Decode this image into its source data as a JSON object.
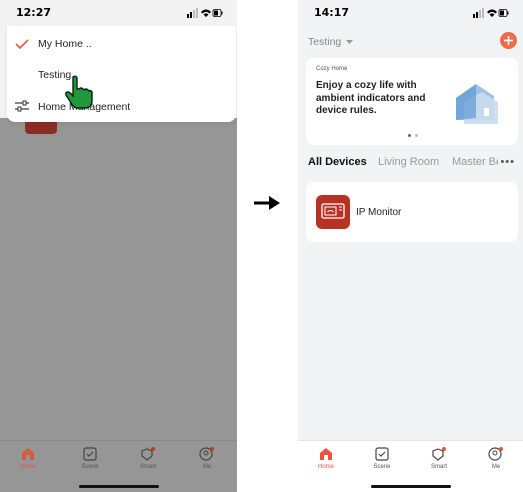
{
  "left_screen": {
    "status_time": "12:27",
    "dropdown": {
      "items": [
        {
          "label": "My Home ..",
          "checked": true
        },
        {
          "label": "Testing",
          "checked": false
        },
        {
          "label": "Home Management",
          "icon": "sliders-icon"
        }
      ]
    },
    "tabbar": [
      {
        "label": "Home",
        "icon": "home-icon",
        "active": true
      },
      {
        "label": "Scene",
        "icon": "checkbox-icon",
        "active": false
      },
      {
        "label": "Smart",
        "icon": "smart-icon",
        "active": false,
        "badge": true
      },
      {
        "label": "Me",
        "icon": "profile-icon",
        "active": false,
        "badge": true
      }
    ]
  },
  "arrow_icon": "right-arrow-icon",
  "right_screen": {
    "status_time": "14:17",
    "home_select": "Testing",
    "banner": {
      "tag": "Cozy Home",
      "text": "Enjoy a cozy life with ambient indicators and device rules."
    },
    "room_tabs": [
      "All Devices",
      "Living Room",
      "Master Be"
    ],
    "devices": [
      {
        "name": "IP Monitor",
        "icon": "monitor-icon"
      }
    ],
    "tabbar": [
      {
        "label": "Home",
        "icon": "home-icon",
        "active": true
      },
      {
        "label": "Scene",
        "icon": "checkbox-icon",
        "active": false
      },
      {
        "label": "Smart",
        "icon": "smart-icon",
        "active": false,
        "badge": true
      },
      {
        "label": "Me",
        "icon": "profile-icon",
        "active": false,
        "badge": true
      }
    ]
  },
  "colors": {
    "accent": "#e8553e",
    "device_icon": "#b83224",
    "overlay": "#969696"
  }
}
